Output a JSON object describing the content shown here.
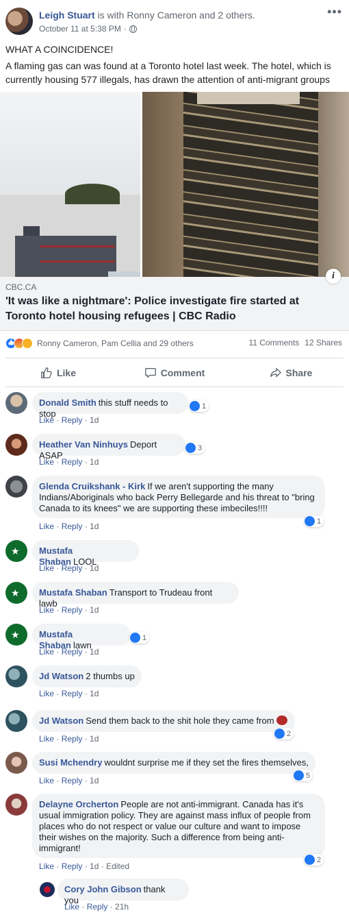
{
  "post": {
    "author": "Leigh Stuart",
    "with_text": " is with Ronny Cameron and 2 others.",
    "timestamp": "October 11 at 5:38 PM",
    "separator": "·",
    "headline": "WHAT A COINCIDENCE!",
    "body": "A flaming gas can was found at a Toronto hotel last week. The hotel, which is currently housing 577 illegals, has drawn the attention of anti-migrant groups"
  },
  "link": {
    "domain": "CBC.CA",
    "title": "'It was like a nightmare': Police investigate fire started at Toronto hotel housing refugees | CBC Radio",
    "info_glyph": "i"
  },
  "stats": {
    "reactors": "Ronny Cameron, Pam Cellia and 29 others",
    "comments": "11 Comments",
    "shares": "12 Shares"
  },
  "actions": {
    "like": "Like",
    "comment": "Comment",
    "share": "Share"
  },
  "comments": [
    {
      "name": "Donald Smith",
      "text": "this stuff needs to stop",
      "like": "Like",
      "reply": "Reply",
      "age": "1d",
      "reactions": "1"
    },
    {
      "name": "Heather Van Ninhuys",
      "text": "Deport ASAP",
      "like": "Like",
      "reply": "Reply",
      "age": "1d",
      "reactions": "3"
    },
    {
      "name": "Glenda Cruikshank - Kirk",
      "text": "If we aren't supporting the many Indians/Aboriginals who back Perry Bellegarde and his threat to \"bring Canada to its knees\" we are supporting these imbeciles!!!!",
      "like": "Like",
      "reply": "Reply",
      "age": "1d",
      "reactions": "1"
    },
    {
      "name": "Mustafa Shaban",
      "text": "LOOL",
      "like": "Like",
      "reply": "Reply",
      "age": "1d"
    },
    {
      "name": "Mustafa Shaban",
      "text": "Transport to Trudeau front lawb",
      "like": "Like",
      "reply": "Reply",
      "age": "1d"
    },
    {
      "name": "Mustafa Shaban",
      "text": "lawn",
      "like": "Like",
      "reply": "Reply",
      "age": "1d",
      "reactions": "1"
    },
    {
      "name": "Jd Watson",
      "text": "2 thumbs up",
      "like": "Like",
      "reply": "Reply",
      "age": "1d"
    },
    {
      "name": "Jd Watson",
      "text": "Send them back to the shit hole they came from",
      "like": "Like",
      "reply": "Reply",
      "age": "1d",
      "reactions": "2"
    },
    {
      "name": "Susi Mchendry",
      "text": "wouldnt surprise me if they set the fires themselves,",
      "like": "Like",
      "reply": "Reply",
      "age": "1d",
      "reactions": "5"
    },
    {
      "name": "Delayne Orcherton",
      "text": "People are not anti-immigrant. Canada has it's usual immigration policy. They are against mass influx of people from places who do not respect or value our culture and want to impose their wishes on the majority. Such a difference from being anti-immigrant!",
      "like": "Like",
      "reply": "Reply",
      "age": "1d",
      "edited": "Edited",
      "reactions": "2"
    },
    {
      "name": "Cory John Gibson",
      "text": "thank you",
      "like": "Like",
      "reply": "Reply",
      "age": "21h"
    }
  ]
}
